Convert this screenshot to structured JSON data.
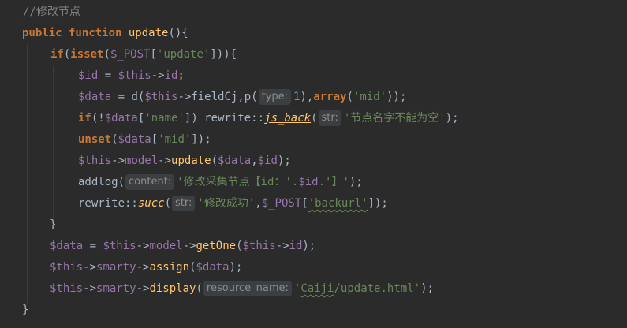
{
  "editor": {
    "hints": {
      "type": "type:",
      "str": "str:",
      "content": "content:",
      "resource_name": "resource_name:"
    },
    "lines": [
      {
        "comment": "//修改节点"
      },
      {
        "kw": "public function",
        "name": "update",
        "rest": "(){"
      },
      {
        "kw": "if",
        "p1": "(",
        "kw2": "isset",
        "p2": "(",
        "var": "$_POST",
        "p3": "[",
        "str": "'update'",
        "p4": "])){"
      },
      {
        "var1": "$id",
        "op": " = ",
        "var2": "$this",
        "arrow": "->",
        "var3": "id",
        "end": ";"
      },
      {
        "var1": "$data",
        "op": " = d(",
        "var2": "$this",
        "arrow": "->fieldCj,p(",
        "num": "1",
        "mid": "),",
        "kw": "array",
        "open": "(",
        "str": "'mid'",
        "end": "));"
      },
      {
        "kw": "if",
        "p1": "(!",
        "var": "$data",
        "p2": "[",
        "str": "'name'",
        "p3": "]) rewrite::",
        "fn": "js_back",
        "p4": "(",
        "str2": "'节点名字不能为空'",
        "end": ");"
      },
      {
        "kw": "unset",
        "p1": "(",
        "var": "$data",
        "p2": "[",
        "str": "'mid'",
        "end": "]);"
      },
      {
        "var1": "$this",
        "arrow": "->",
        "var2": "model",
        "arrow2": "->",
        "fn": "update",
        "p1": "(",
        "var3": "$data",
        "comma": ",",
        "var4": "$id",
        "end": ");"
      },
      {
        "name": "addlog",
        "p1": "(",
        "str": "'修改采集节点【id：'.",
        "var": "$id",
        "str2": ".'】'",
        "end": ");"
      },
      {
        "name": "rewrite::",
        "fn": "succ",
        "p1": "(",
        "str": "'修改成功'",
        "comma": ",",
        "var": "$_POST",
        "p2": "[",
        "str2": "'backurl'",
        "end": "]);"
      },
      {
        "text": "}"
      },
      {
        "var1": "$data",
        "op": " = ",
        "var2": "$this",
        "arrow": "->",
        "var3": "model",
        "arrow2": "->",
        "fn": "getOne",
        "p1": "(",
        "var4": "$this",
        "arrow3": "->",
        "var5": "id",
        "end": ");"
      },
      {
        "var1": "$this",
        "arrow": "->",
        "var2": "smarty",
        "arrow2": "->",
        "fn": "assign",
        "p1": "(",
        "var3": "$data",
        "end": ");"
      },
      {
        "var1": "$this",
        "arrow": "->",
        "var2": "smarty",
        "arrow2": "->",
        "fn": "display",
        "p1": "(",
        "str": "'",
        "str2": "Caiji",
        "str3": "/update.html'",
        "end": ");"
      },
      {
        "text": "}"
      }
    ]
  }
}
